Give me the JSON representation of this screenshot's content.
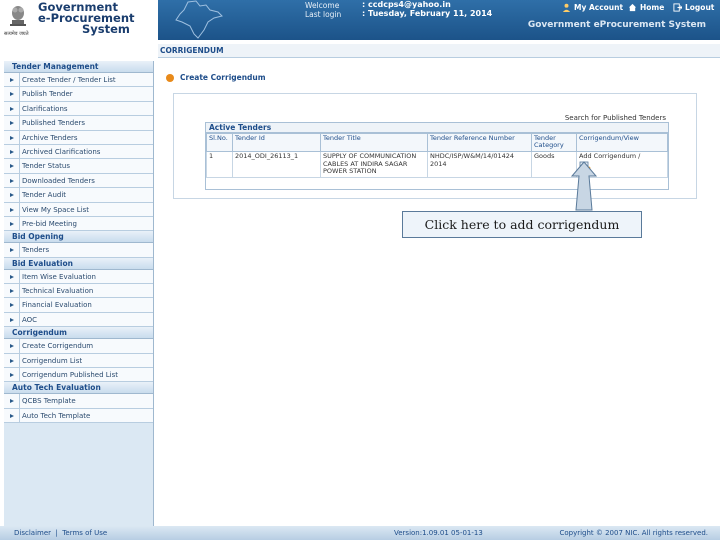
{
  "header": {
    "logo_line1": "Government",
    "logo_line2": "e-Procurement",
    "logo_line3": "System",
    "emblem_caption": "सत्यमेव जयते",
    "welcome_label": "Welcome",
    "welcome_value": ": ccdcps4@yahoo.in",
    "last_login_label": "Last login",
    "last_login_value": ": Tuesday, February 11, 2014",
    "my_account": "My Account",
    "home": "Home",
    "logout": "Logout",
    "system_title": "Government eProcurement System"
  },
  "breadcrumb": "CORRIGENDUM",
  "action_title": "Create Corrigendum",
  "sidebar": [
    {
      "section": "Tender Management",
      "items": [
        "Create Tender / Tender List",
        "Publish Tender",
        "Clarifications",
        "Published Tenders",
        "Archive Tenders",
        "Archived Clarifications",
        "Tender Status",
        "Downloaded Tenders",
        "Tender Audit",
        "View My Space List",
        "Pre-bid Meeting"
      ]
    },
    {
      "section": "Bid Opening",
      "items": [
        "Tenders"
      ]
    },
    {
      "section": "Bid Evaluation",
      "items": [
        "Item Wise Evaluation",
        "Technical Evaluation",
        "Financial Evaluation",
        "AOC"
      ]
    },
    {
      "section": "Corrigendum",
      "items": [
        "Create Corrigendum",
        "Corrigendum List",
        "Corrigendum Published List"
      ]
    },
    {
      "section": "Auto Tech Evaluation",
      "items": [
        "QCBS Template",
        "Auto Tech Template"
      ]
    }
  ],
  "search_link": "Search for Published Tenders",
  "grid": {
    "title": "Active Tenders",
    "columns": [
      "Sl.No.",
      "Tender Id",
      "Tender Title",
      "Tender Reference Number",
      "Tender Category",
      "Corrigendum/View"
    ],
    "rows": [
      [
        "1",
        "2014_ODI_26113_1",
        "SUPPLY OF COMMUNICATION CABLES AT INDIRA SAGAR POWER STATION",
        "NHDC/ISP/W&M/14/01424 2014",
        "Goods",
        "Add Corrigendum /"
      ]
    ]
  },
  "callout": "Click here to add corrigendum",
  "footer": {
    "disclaimer": "Disclaimer",
    "terms": "Terms of Use",
    "version": "Version:1.09.01 05-01-13",
    "copyright": "Copyright © 2007 NIC. All rights reserved."
  },
  "colors": {
    "header": "#1c5389",
    "accent": "#1e4d8a",
    "action_dot": "#e88a1a"
  }
}
